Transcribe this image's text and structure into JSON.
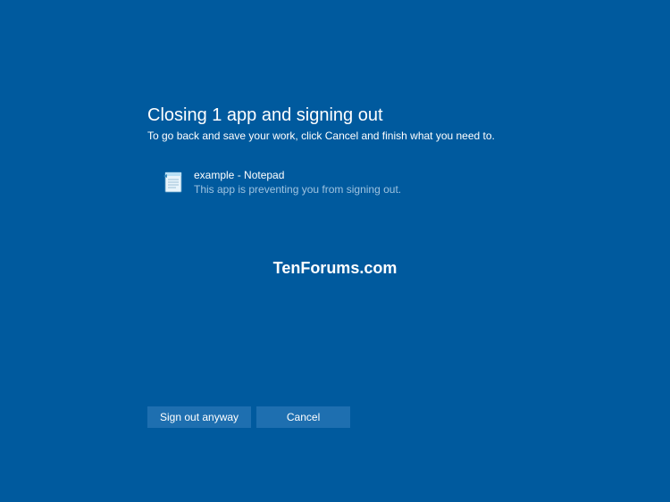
{
  "heading": "Closing 1 app and signing out",
  "subheading": "To go back and save your work, click Cancel and finish what you need to.",
  "app": {
    "name": "example - Notepad",
    "message": "This app is preventing you from signing out."
  },
  "watermark": "TenForums.com",
  "buttons": {
    "primary": "Sign out anyway",
    "cancel": "Cancel"
  }
}
